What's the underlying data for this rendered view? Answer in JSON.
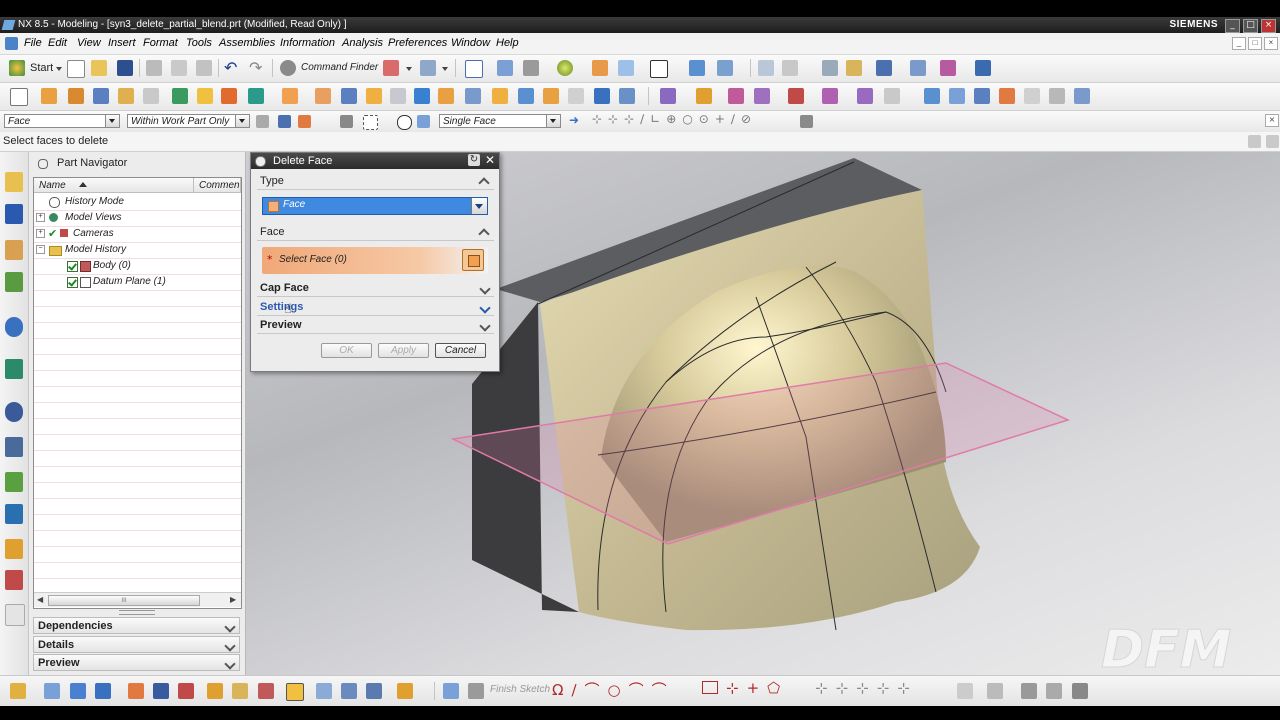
{
  "window": {
    "title": "NX 8.5 - Modeling - [syn3_delete_partial_blend.prt (Modified, Read Only) ]",
    "brand": "SIEMENS",
    "controls": [
      "_",
      "□",
      "×"
    ]
  },
  "menu": {
    "items": [
      "File",
      "Edit",
      "View",
      "Insert",
      "Format",
      "Tools",
      "Assemblies",
      "Information",
      "Analysis",
      "Preferences",
      "Window",
      "Help"
    ]
  },
  "toolbar": {
    "start_label": "Start",
    "command_finder_label": "Command Finder"
  },
  "selection_bar": {
    "filter_value": "Face",
    "scope_value": "Within Work Part Only",
    "face_rule_value": "Single Face"
  },
  "cue_line": "Select faces to delete",
  "navigator": {
    "title": "Part Navigator",
    "columns": [
      "Name",
      "Commen"
    ],
    "nodes": [
      {
        "label": "History Mode"
      },
      {
        "label": "Model Views"
      },
      {
        "label": "Cameras"
      },
      {
        "label": "Model History"
      },
      {
        "label": "Body (0)"
      },
      {
        "label": "Datum Plane (1)"
      }
    ],
    "scroll_thumb_label": "III",
    "panels": [
      "Dependencies",
      "Details",
      "Preview"
    ]
  },
  "dialog": {
    "title": "Delete Face",
    "type_section": "Type",
    "type_value": "Face",
    "face_section": "Face",
    "select_face_label": "Select Face (0)",
    "required_marker": "*",
    "cap_face_section": "Cap Face",
    "settings_section": "Settings",
    "preview_section": "Preview",
    "ok_label": "OK",
    "apply_label": "Apply",
    "cancel_label": "Cancel"
  },
  "bottom_toolbar": {
    "finish_sketch_label": "Finish Sketch"
  },
  "watermark": "DFM",
  "colors": {
    "title_bar": "#2b2b2b",
    "selection_highlight": "#3f8ae0",
    "select_face_bg": "#f2b07a",
    "body_surface": "#c9bf9a",
    "datum_plane": "#e07aa8",
    "body_dark_side": "#3c3c3e"
  }
}
